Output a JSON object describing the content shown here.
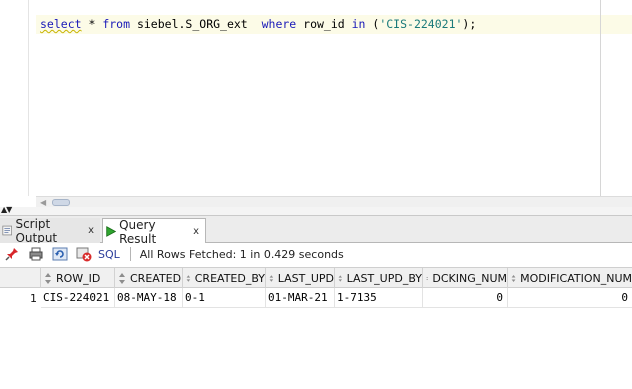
{
  "editor": {
    "sql": {
      "select_kw": "select",
      "star": " * ",
      "from_kw": "from",
      "table": " siebel.S_ORG_ext  ",
      "where_kw": "where",
      "column": " row_id ",
      "in_kw": "in",
      "open": " (",
      "literal": "'CIS-224021'",
      "close": ");"
    }
  },
  "tabs": [
    {
      "label": "Script Output",
      "close": "x",
      "icon": "script-output-icon",
      "active": false
    },
    {
      "label": "Query Result",
      "close": "x",
      "icon": "run-triangle-icon",
      "active": true
    }
  ],
  "toolbar": {
    "sql_label": "SQL",
    "status": "All Rows Fetched: 1 in 0.429 seconds",
    "icons": [
      "pin-icon",
      "print-icon",
      "refresh-icon",
      "cancel-icon"
    ]
  },
  "grid": {
    "columns": [
      "ROW_ID",
      "CREATED",
      "CREATED_BY",
      "LAST_UPD",
      "LAST_UPD_BY",
      "DCKING_NUM",
      "MODIFICATION_NUM"
    ],
    "rows": [
      {
        "num": "1",
        "cells": [
          "CIS-224021",
          "08-MAY-18",
          "0-1",
          "01-MAR-21",
          "1-7135",
          "0",
          "0"
        ]
      }
    ]
  },
  "colors": {
    "keyword": "#1a1ab8",
    "string": "#1a7a7a",
    "current_line": "#fcfbe7"
  }
}
